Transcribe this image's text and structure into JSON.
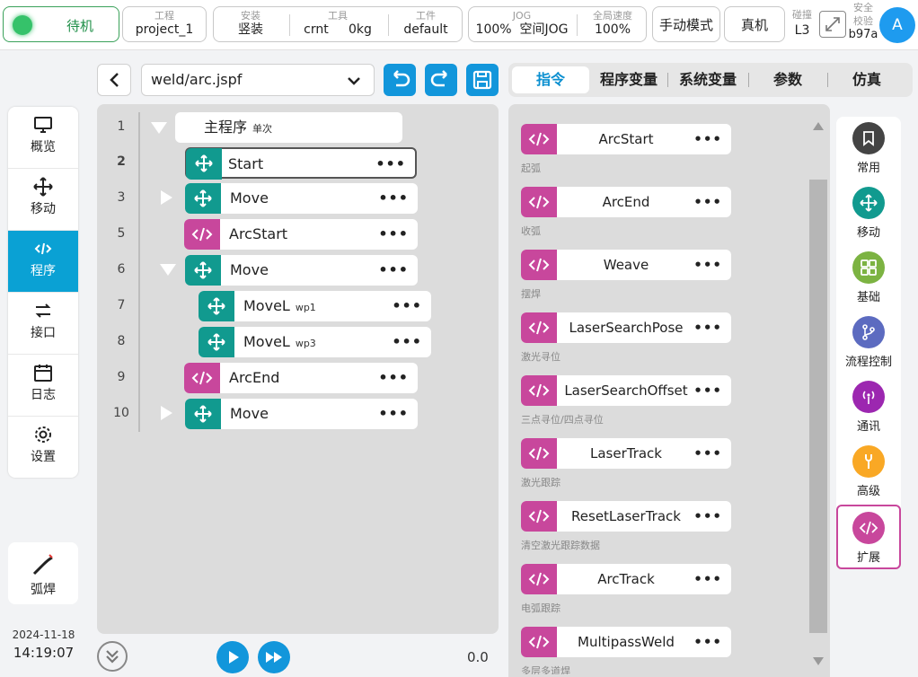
{
  "topbar": {
    "status": "待机",
    "project": {
      "label": "工程",
      "value": "project_1"
    },
    "install": {
      "label": "安装",
      "value": "竖装"
    },
    "tool": {
      "label": "工具",
      "value": "crnt",
      "load": "0kg"
    },
    "workpiece": {
      "label": "工件",
      "value": "default"
    },
    "jog": {
      "label": "JOG",
      "speed": "100%",
      "mode": "空间JOG"
    },
    "global_speed": {
      "label": "全局速度",
      "value": "100%"
    },
    "manual_mode": "手动模式",
    "real_robot": "真机",
    "collision": {
      "label": "碰撞",
      "value": "L3"
    },
    "safety": {
      "label1": "安全",
      "label2": "校验",
      "value": "b97a"
    },
    "avatar": "A"
  },
  "sidebar": {
    "items": [
      {
        "label": "概览",
        "icon": "monitor-icon"
      },
      {
        "label": "移动",
        "icon": "move-icon"
      },
      {
        "label": "程序",
        "icon": "code-icon"
      },
      {
        "label": "接口",
        "icon": "swap-icon"
      },
      {
        "label": "日志",
        "icon": "calendar-icon"
      },
      {
        "label": "设置",
        "icon": "gear-icon"
      }
    ],
    "weld_label": "弧焊",
    "date": "2024-11-18",
    "time": "14:19:07"
  },
  "editor": {
    "file": "weld/arc.jspf",
    "rows": [
      {
        "num": "1",
        "label": "主程序",
        "tag": "单次"
      },
      {
        "num": "2",
        "label": "Start"
      },
      {
        "num": "3",
        "label": "Move"
      },
      {
        "num": "5",
        "label": "ArcStart"
      },
      {
        "num": "6",
        "label": "Move"
      },
      {
        "num": "7",
        "label": "MoveL",
        "tag": "wp1"
      },
      {
        "num": "8",
        "label": "MoveL",
        "tag": "wp3"
      },
      {
        "num": "9",
        "label": "ArcEnd"
      },
      {
        "num": "10",
        "label": "Move"
      }
    ],
    "progress": "0.0"
  },
  "tabs": [
    "指令",
    "程序变量",
    "系统变量",
    "参数",
    "仿真"
  ],
  "commands": [
    {
      "name": "ArcStart",
      "desc": "起弧"
    },
    {
      "name": "ArcEnd",
      "desc": "收弧"
    },
    {
      "name": "Weave",
      "desc": "摆焊"
    },
    {
      "name": "LaserSearchPose",
      "desc": "激光寻位"
    },
    {
      "name": "LaserSearchOffset",
      "desc": "三点寻位/四点寻位"
    },
    {
      "name": "LaserTrack",
      "desc": "激光跟踪"
    },
    {
      "name": "ResetLaserTrack",
      "desc": "清空激光跟踪数据"
    },
    {
      "name": "ArcTrack",
      "desc": "电弧跟踪"
    },
    {
      "name": "MultipassWeld",
      "desc": "多层多道焊"
    }
  ],
  "categories": [
    {
      "label": "常用",
      "color": "#444444"
    },
    {
      "label": "移动",
      "color": "#119a8f"
    },
    {
      "label": "基础",
      "color": "#7cb342"
    },
    {
      "label": "流程控制",
      "color": "#5c6bc0"
    },
    {
      "label": "通讯",
      "color": "#9c27b0"
    },
    {
      "label": "高级",
      "color": "#f9a825"
    },
    {
      "label": "扩展",
      "color": "#c8479c"
    }
  ],
  "colors": {
    "accent": "#0aa1d4",
    "teal": "#119a8f",
    "pink": "#c8479c"
  }
}
